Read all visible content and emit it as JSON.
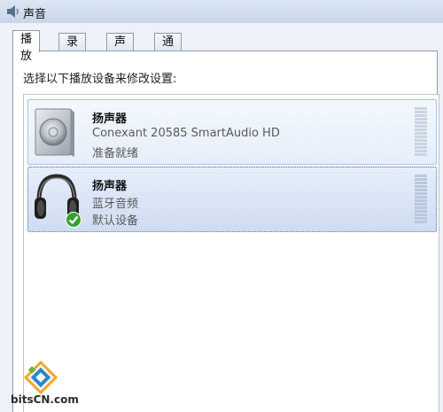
{
  "window": {
    "title": "声音",
    "app_icon": "speaker-icon"
  },
  "tabs": [
    {
      "label": "播放",
      "active": true
    },
    {
      "label": "录制",
      "active": false
    },
    {
      "label": "声音",
      "active": false
    },
    {
      "label": "通信",
      "active": false
    }
  ],
  "instructions": "选择以下播放设备来修改设置:",
  "devices": [
    {
      "name": "扬声器",
      "description": "Conexant 20585 SmartAudio HD",
      "status": "准备就绪",
      "icon": "speaker-device-icon",
      "selected": false
    },
    {
      "name": "扬声器",
      "description": "蓝牙音频",
      "status": "默认设备",
      "icon": "headphones-icon",
      "badge_icon": "default-check-icon",
      "selected": true
    }
  ],
  "watermark": {
    "text": "bitsCN.com",
    "icon": "bitscn-logo-icon"
  },
  "colors": {
    "selection_fill": "#cfdcf0",
    "default_badge": "#35a135"
  }
}
